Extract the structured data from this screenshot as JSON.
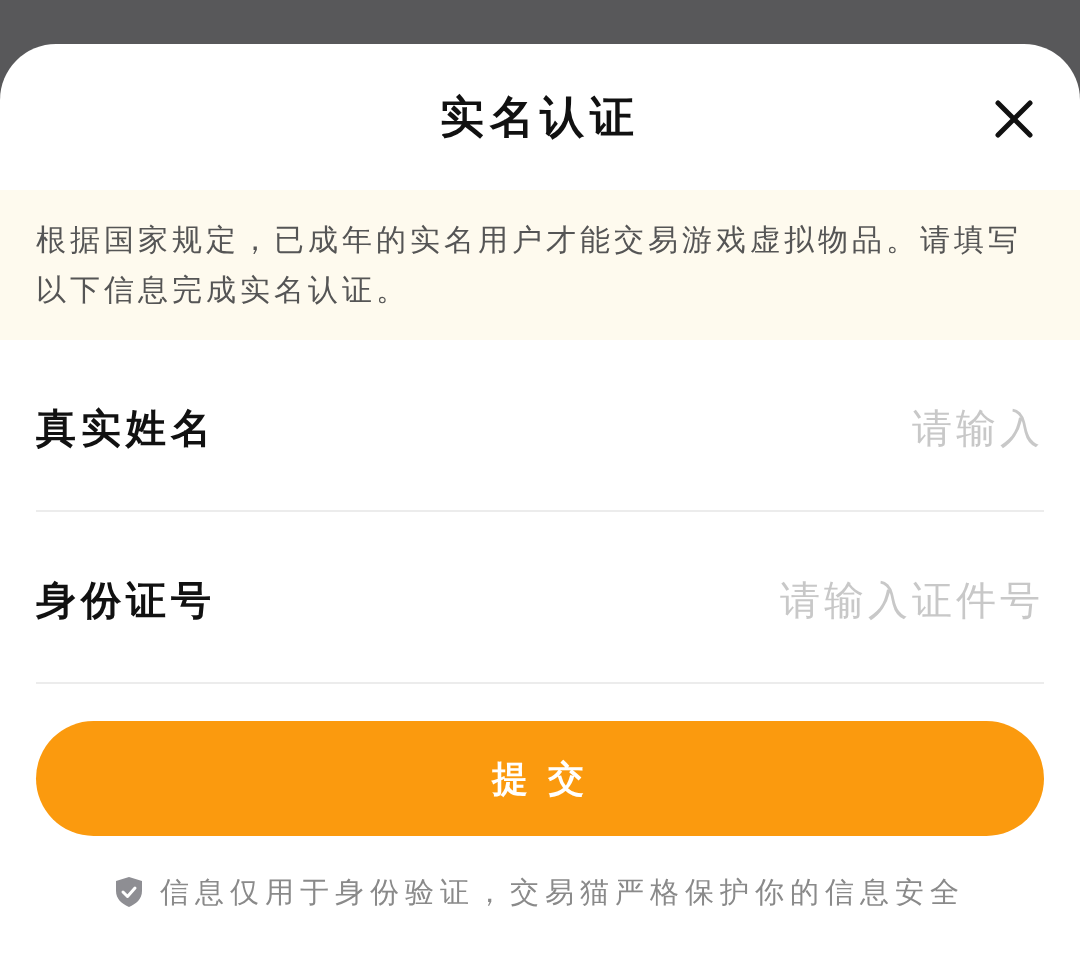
{
  "dialog": {
    "title": "实名认证"
  },
  "notice": "根据国家规定，已成年的实名用户才能交易游戏虚拟物品。请填写以下信息完成实名认证。",
  "fields": [
    {
      "label": "真实姓名",
      "placeholder": "请输入"
    },
    {
      "label": "身份证号",
      "placeholder": "请输入证件号"
    }
  ],
  "submit_button": "提 交",
  "privacy_note": "信息仅用于身份验证，交易猫严格保护你的信息安全"
}
